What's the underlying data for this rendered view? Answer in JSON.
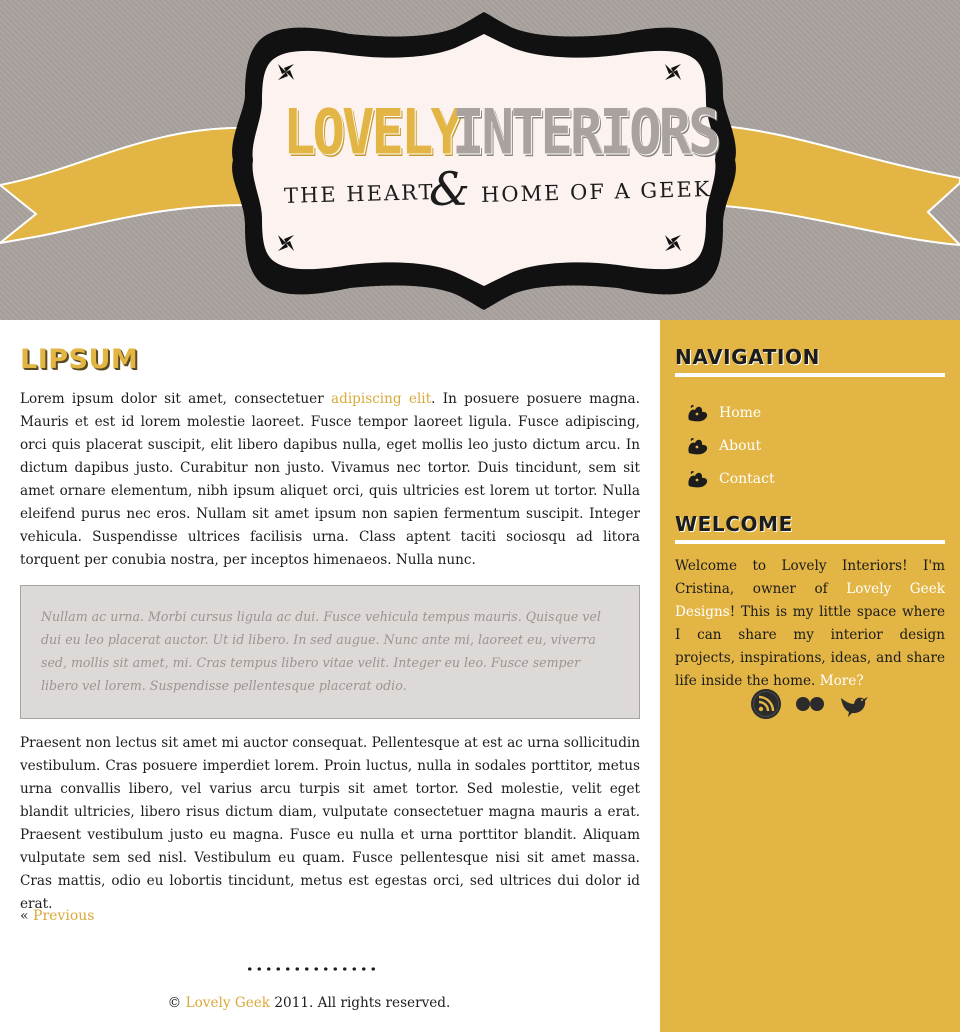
{
  "header": {
    "logo_word1": "LOVELY",
    "logo_word2": "INTERIORS",
    "tagline_left": "The Heart",
    "tagline_amp": "&",
    "tagline_right": "Home of a Geek",
    "colors": {
      "background": "#a9a29f",
      "ribbon": "#e2b544",
      "plaque": "#fcf3f1",
      "frame": "#1c1c1c"
    }
  },
  "post": {
    "title": "LIPSUM",
    "p1_before_link": "Lorem ipsum dolor sit amet, consectetuer ",
    "p1_link": "adipiscing elit",
    "p1_after_link": ". In posuere posuere magna. Mauris et est id lorem molestie laoreet. Fusce tempor laoreet ligula. Fusce adipiscing, orci quis placerat suscipit, elit libero dapibus nulla, eget mollis leo justo dictum arcu. In dictum dapibus justo. Curabitur non justo. Vivamus nec tortor. Duis tincidunt, sem sit amet ornare elementum, nibh ipsum aliquet orci, quis ultricies est lorem ut tortor. Nulla eleifend purus nec eros. Nullam sit amet ipsum non sapien fermentum suscipit. Integer vehicula. Suspendisse ultrices facilisis urna. Class aptent taciti sociosqu ad litora torquent per conubia nostra, per inceptos himenaeos. Nulla nunc.",
    "blockquote": "Nullam ac urna. Morbi cursus ligula ac dui. Fusce vehicula tempus mauris. Quisque vel dui eu leo placerat auctor. Ut id libero. In sed augue. Nunc ante mi, laoreet eu, viverra sed, mollis sit amet, mi. Cras tempus libero vitae velit. Integer eu leo. Fusce semper libero vel lorem. Suspendisse pellentesque placerat odio.",
    "p2": "Praesent non lectus sit amet mi auctor consequat. Pellentesque at est ac urna sollicitudin vestibulum. Cras posuere imperdiet lorem. Proin luctus, nulla in sodales porttitor, metus urna convallis libero, vel varius arcu turpis sit amet tortor. Sed molestie, velit eget blandit ultricies, libero risus dictum diam, vulputate consectetuer magna mauris a erat. Praesent vestibulum justo eu magna. Fusce eu nulla et urna porttitor blandit. Aliquam vulputate sem sed nisl. Vestibulum eu quam. Fusce pellentesque nisi sit amet massa. Cras mattis, odio eu lobortis tincidunt, metus est egestas orci, sed ultrices dui dolor id erat.",
    "prev_prefix": "«",
    "prev_label": "Previous"
  },
  "footer": {
    "copyright_symbol": "©",
    "brand_link": "Lovely Geek",
    "rest": "2011. All rights reserved."
  },
  "sidebar": {
    "nav_heading": "NAVIGATION",
    "nav_items": [
      {
        "label": "Home",
        "icon": "squirrel-icon"
      },
      {
        "label": "About",
        "icon": "squirrel-icon"
      },
      {
        "label": "Contact",
        "icon": "squirrel-icon"
      }
    ],
    "welcome_heading": "WELCOME",
    "welcome_part1": "Welcome to Lovely Interiors! I'm Cristina, owner of ",
    "welcome_link": "Lovely Geek Designs",
    "welcome_part2": "! This is my little space where I can share my interior design projects, inspirations, ideas, and share life inside the home. ",
    "welcome_more": "More?",
    "social_icons": [
      "rss-icon",
      "flickr-icon",
      "twitter-bird-icon"
    ],
    "accent_color": "#e2b544"
  }
}
